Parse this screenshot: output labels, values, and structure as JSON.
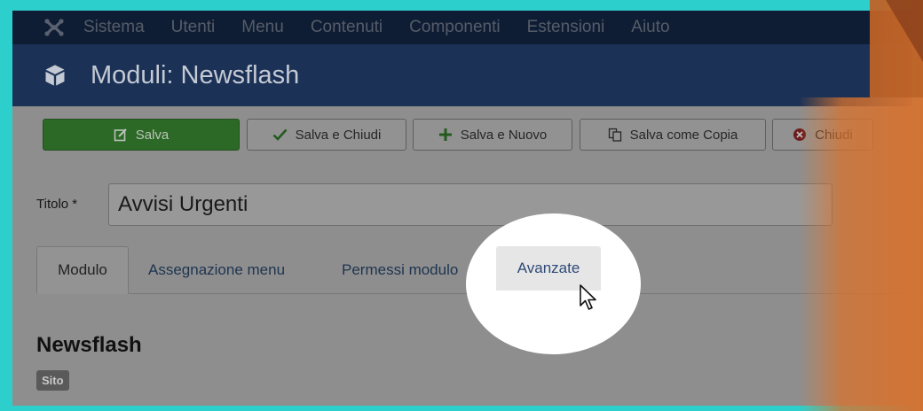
{
  "navbar": {
    "logo_icon": "joomla-logo-icon",
    "items": [
      "Sistema",
      "Utenti",
      "Menu",
      "Contenuti",
      "Componenti",
      "Estensioni",
      "Aiuto"
    ]
  },
  "titlebar": {
    "icon": "cube-icon",
    "title": "Moduli: Newsflash"
  },
  "toolbar": {
    "save_label": "Salva",
    "save_close_label": "Salva e Chiudi",
    "save_new_label": "Salva e Nuovo",
    "save_copy_label": "Salva come Copia",
    "close_label": "Chiudi"
  },
  "form": {
    "title_label": "Titolo *",
    "title_value": "Avvisi Urgenti"
  },
  "tabs": [
    {
      "label": "Modulo"
    },
    {
      "label": "Assegnazione menu"
    },
    {
      "label": "Permessi modulo"
    },
    {
      "label": "Avanzate"
    }
  ],
  "section": {
    "title": "Newsflash",
    "badge": "Sito"
  },
  "colors": {
    "frame": "#2ccfcc",
    "navbar": "#0f1d34",
    "titlebar": "#1b3156",
    "save_button": "#2d6926",
    "accent_orange": "#e07a30",
    "highlight": "#ffffff"
  }
}
